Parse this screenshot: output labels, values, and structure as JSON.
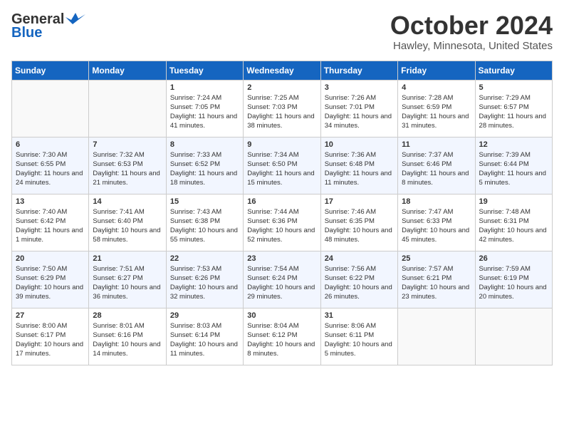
{
  "header": {
    "logo_line1": "General",
    "logo_line2": "Blue",
    "month_title": "October 2024",
    "location": "Hawley, Minnesota, United States"
  },
  "days_of_week": [
    "Sunday",
    "Monday",
    "Tuesday",
    "Wednesday",
    "Thursday",
    "Friday",
    "Saturday"
  ],
  "weeks": [
    [
      {
        "day": "",
        "info": ""
      },
      {
        "day": "",
        "info": ""
      },
      {
        "day": "1",
        "info": "Sunrise: 7:24 AM\nSunset: 7:05 PM\nDaylight: 11 hours and 41 minutes."
      },
      {
        "day": "2",
        "info": "Sunrise: 7:25 AM\nSunset: 7:03 PM\nDaylight: 11 hours and 38 minutes."
      },
      {
        "day": "3",
        "info": "Sunrise: 7:26 AM\nSunset: 7:01 PM\nDaylight: 11 hours and 34 minutes."
      },
      {
        "day": "4",
        "info": "Sunrise: 7:28 AM\nSunset: 6:59 PM\nDaylight: 11 hours and 31 minutes."
      },
      {
        "day": "5",
        "info": "Sunrise: 7:29 AM\nSunset: 6:57 PM\nDaylight: 11 hours and 28 minutes."
      }
    ],
    [
      {
        "day": "6",
        "info": "Sunrise: 7:30 AM\nSunset: 6:55 PM\nDaylight: 11 hours and 24 minutes."
      },
      {
        "day": "7",
        "info": "Sunrise: 7:32 AM\nSunset: 6:53 PM\nDaylight: 11 hours and 21 minutes."
      },
      {
        "day": "8",
        "info": "Sunrise: 7:33 AM\nSunset: 6:52 PM\nDaylight: 11 hours and 18 minutes."
      },
      {
        "day": "9",
        "info": "Sunrise: 7:34 AM\nSunset: 6:50 PM\nDaylight: 11 hours and 15 minutes."
      },
      {
        "day": "10",
        "info": "Sunrise: 7:36 AM\nSunset: 6:48 PM\nDaylight: 11 hours and 11 minutes."
      },
      {
        "day": "11",
        "info": "Sunrise: 7:37 AM\nSunset: 6:46 PM\nDaylight: 11 hours and 8 minutes."
      },
      {
        "day": "12",
        "info": "Sunrise: 7:39 AM\nSunset: 6:44 PM\nDaylight: 11 hours and 5 minutes."
      }
    ],
    [
      {
        "day": "13",
        "info": "Sunrise: 7:40 AM\nSunset: 6:42 PM\nDaylight: 11 hours and 1 minute."
      },
      {
        "day": "14",
        "info": "Sunrise: 7:41 AM\nSunset: 6:40 PM\nDaylight: 10 hours and 58 minutes."
      },
      {
        "day": "15",
        "info": "Sunrise: 7:43 AM\nSunset: 6:38 PM\nDaylight: 10 hours and 55 minutes."
      },
      {
        "day": "16",
        "info": "Sunrise: 7:44 AM\nSunset: 6:36 PM\nDaylight: 10 hours and 52 minutes."
      },
      {
        "day": "17",
        "info": "Sunrise: 7:46 AM\nSunset: 6:35 PM\nDaylight: 10 hours and 48 minutes."
      },
      {
        "day": "18",
        "info": "Sunrise: 7:47 AM\nSunset: 6:33 PM\nDaylight: 10 hours and 45 minutes."
      },
      {
        "day": "19",
        "info": "Sunrise: 7:48 AM\nSunset: 6:31 PM\nDaylight: 10 hours and 42 minutes."
      }
    ],
    [
      {
        "day": "20",
        "info": "Sunrise: 7:50 AM\nSunset: 6:29 PM\nDaylight: 10 hours and 39 minutes."
      },
      {
        "day": "21",
        "info": "Sunrise: 7:51 AM\nSunset: 6:27 PM\nDaylight: 10 hours and 36 minutes."
      },
      {
        "day": "22",
        "info": "Sunrise: 7:53 AM\nSunset: 6:26 PM\nDaylight: 10 hours and 32 minutes."
      },
      {
        "day": "23",
        "info": "Sunrise: 7:54 AM\nSunset: 6:24 PM\nDaylight: 10 hours and 29 minutes."
      },
      {
        "day": "24",
        "info": "Sunrise: 7:56 AM\nSunset: 6:22 PM\nDaylight: 10 hours and 26 minutes."
      },
      {
        "day": "25",
        "info": "Sunrise: 7:57 AM\nSunset: 6:21 PM\nDaylight: 10 hours and 23 minutes."
      },
      {
        "day": "26",
        "info": "Sunrise: 7:59 AM\nSunset: 6:19 PM\nDaylight: 10 hours and 20 minutes."
      }
    ],
    [
      {
        "day": "27",
        "info": "Sunrise: 8:00 AM\nSunset: 6:17 PM\nDaylight: 10 hours and 17 minutes."
      },
      {
        "day": "28",
        "info": "Sunrise: 8:01 AM\nSunset: 6:16 PM\nDaylight: 10 hours and 14 minutes."
      },
      {
        "day": "29",
        "info": "Sunrise: 8:03 AM\nSunset: 6:14 PM\nDaylight: 10 hours and 11 minutes."
      },
      {
        "day": "30",
        "info": "Sunrise: 8:04 AM\nSunset: 6:12 PM\nDaylight: 10 hours and 8 minutes."
      },
      {
        "day": "31",
        "info": "Sunrise: 8:06 AM\nSunset: 6:11 PM\nDaylight: 10 hours and 5 minutes."
      },
      {
        "day": "",
        "info": ""
      },
      {
        "day": "",
        "info": ""
      }
    ]
  ]
}
